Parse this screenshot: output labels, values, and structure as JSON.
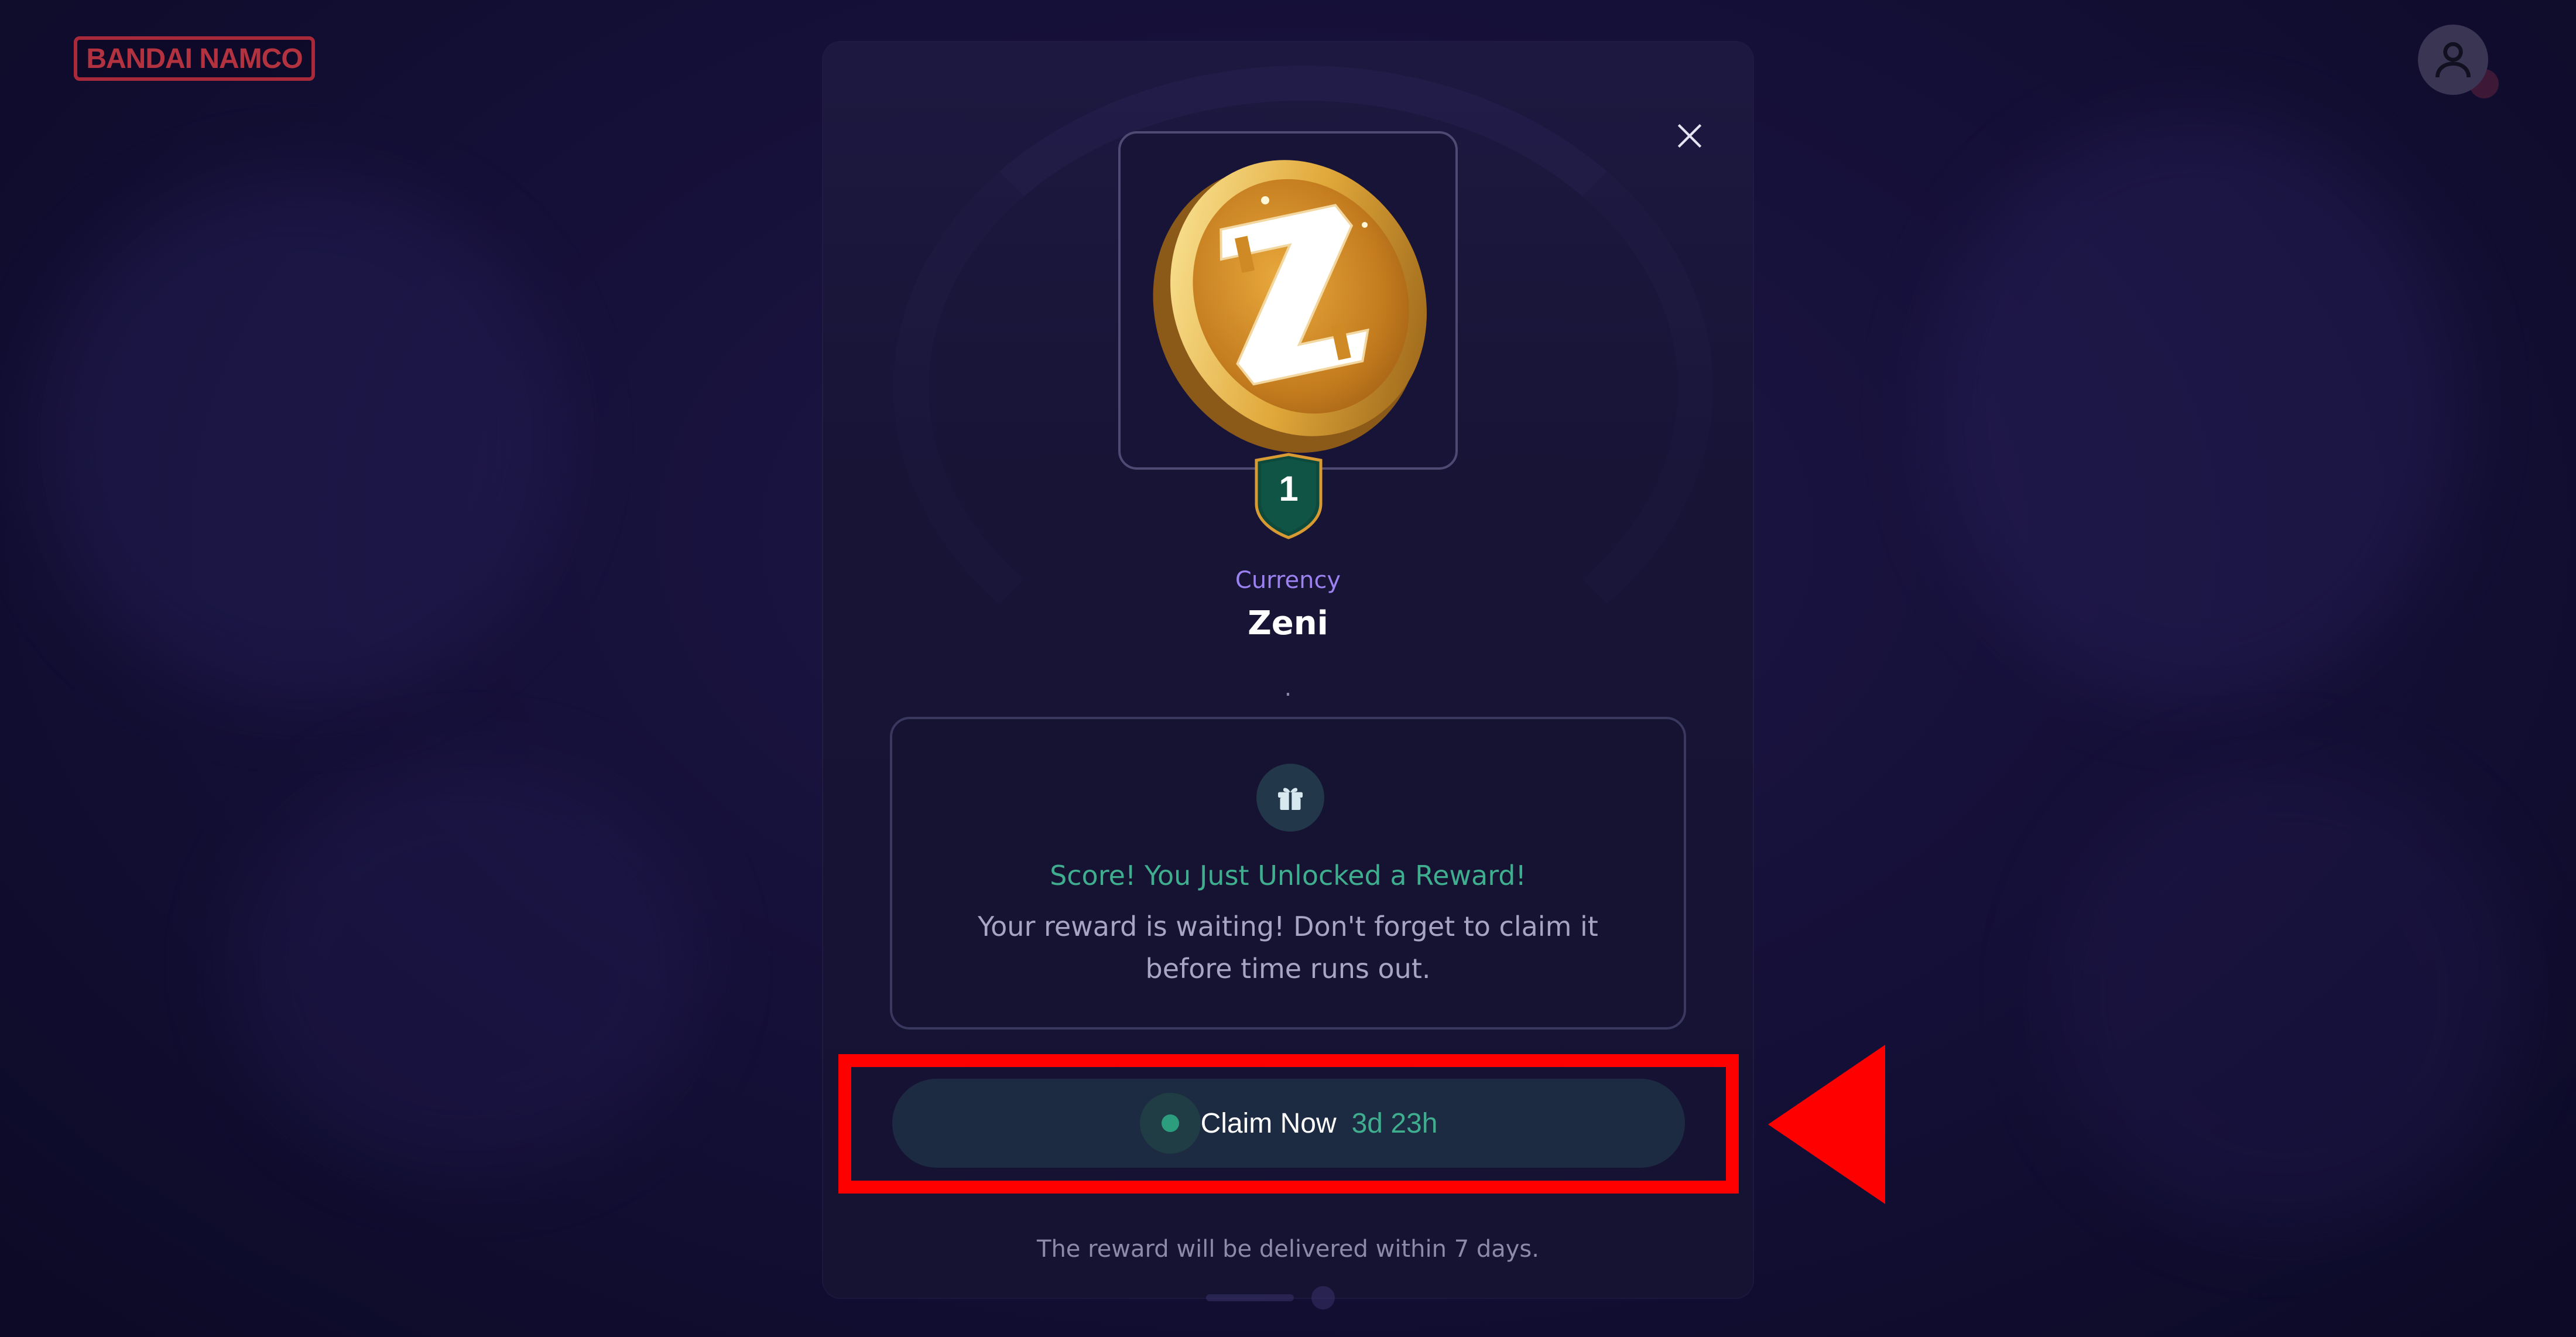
{
  "header": {
    "logo_text": "BANDAI NAMCO",
    "avatar_icon": "user-icon"
  },
  "modal": {
    "close_icon": "close-icon",
    "item": {
      "image_icon": "zeni-coin-icon",
      "quantity": "1",
      "category": "Currency",
      "name": "Zeni",
      "description": "."
    },
    "reward": {
      "icon": "gift-icon",
      "title": "Score! You Just Unlocked a Reward!",
      "description": "Your reward is waiting! Don't forget to claim it before time runs out."
    },
    "claim": {
      "label": "Claim Now",
      "timer": "3d 23h"
    },
    "delivery_note": "The reward will be delivered within 7 days."
  },
  "colors": {
    "accent_green": "#3fae8f",
    "category_purple": "#9b82f0",
    "highlight_red": "#ff0000"
  }
}
